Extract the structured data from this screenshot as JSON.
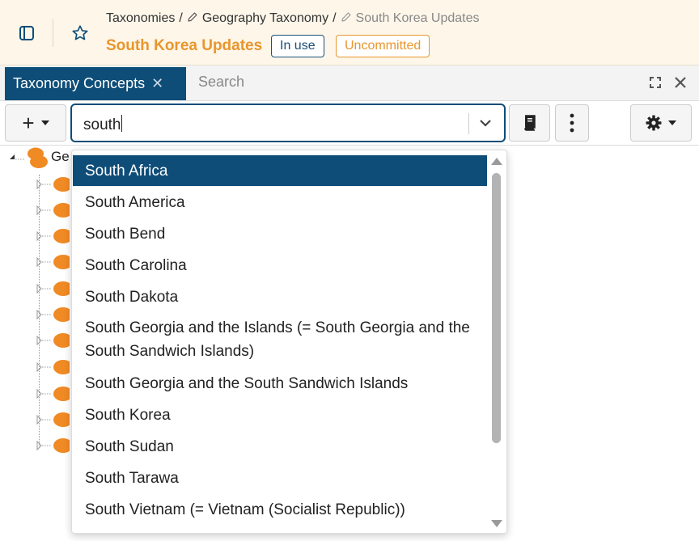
{
  "header": {
    "breadcrumb": {
      "root": "Taxonomies",
      "parent": "Geography Taxonomy",
      "current": "South Korea Updates"
    },
    "title": "South Korea Updates",
    "badges": {
      "in_use": "In use",
      "uncommitted": "Uncommitted"
    }
  },
  "tabs": [
    {
      "label": "Taxonomy Concepts",
      "active": true
    },
    {
      "label": "Search",
      "active": false
    }
  ],
  "toolbar": {
    "add_label": "+",
    "search": {
      "value": "south"
    }
  },
  "tree": {
    "root_label_partial": "Ge"
  },
  "dropdown": {
    "selected_index": 0,
    "options": [
      "South Africa",
      "South America",
      "South Bend",
      "South Carolina",
      "South Dakota",
      "South Georgia and the Islands (= South Georgia and the South Sandwich Islands)",
      "South Georgia and the South Sandwich Islands",
      "South Korea",
      "South Sudan",
      "South Tarawa",
      "South Vietnam (= Vietnam (Socialist Republic))"
    ]
  },
  "colors": {
    "accent": "#0e4d78",
    "brand_orange": "#e8962d",
    "header_bg": "#fdf6e9",
    "tree_node": "#f08a24"
  },
  "icons": {
    "sidebar_toggle": "sidebar-toggle-icon",
    "favorite": "star-icon",
    "edit": "pencil-icon",
    "close": "close-icon",
    "maximize": "maximize-icon",
    "chevron": "chevron-down-icon",
    "book": "book-icon",
    "more": "more-vertical-icon",
    "settings": "gear-icon"
  }
}
